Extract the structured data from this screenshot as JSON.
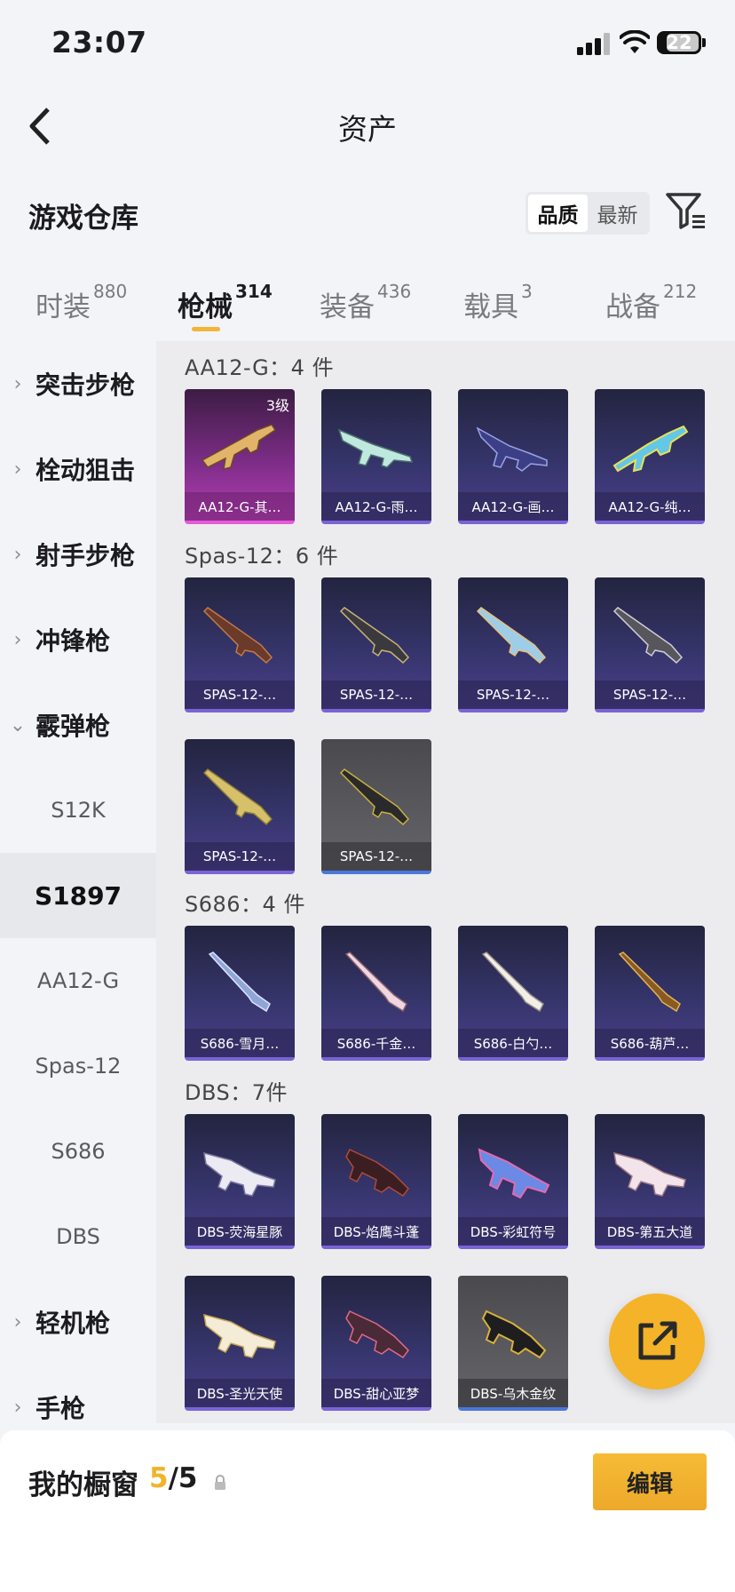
{
  "status_bar": {
    "time": "23:07",
    "battery": "22"
  },
  "nav": {
    "title": "资产"
  },
  "header": {
    "title": "游戏仓库",
    "sort_options": [
      "品质",
      "最新"
    ]
  },
  "tabs": [
    {
      "label": "时装",
      "count": "880"
    },
    {
      "label": "枪械",
      "count": "314"
    },
    {
      "label": "装备",
      "count": "436"
    },
    {
      "label": "载具",
      "count": "3"
    },
    {
      "label": "战备",
      "count": "212"
    }
  ],
  "sidebar": {
    "categories": [
      "突击步枪",
      "栓动狙击",
      "射手步枪",
      "冲锋枪",
      "霰弹枪"
    ],
    "sub_items": [
      "S12K",
      "S1897",
      "AA12-G",
      "Spas-12",
      "S686",
      "DBS"
    ],
    "more_categories": [
      "轻机枪",
      "手枪"
    ]
  },
  "groups": [
    {
      "title": "AA12-G：4 件",
      "items": [
        {
          "name": "AA12-G-其…",
          "level": "3级"
        },
        {
          "name": "AA12-G-雨…"
        },
        {
          "name": "AA12-G-画…"
        },
        {
          "name": "AA12-G-纯…"
        }
      ]
    },
    {
      "title": "Spas-12：6 件",
      "items": [
        {
          "name": "SPAS-12-…"
        },
        {
          "name": "SPAS-12-…"
        },
        {
          "name": "SPAS-12-…"
        },
        {
          "name": "SPAS-12-…"
        },
        {
          "name": "SPAS-12-…"
        },
        {
          "name": "SPAS-12-…"
        }
      ]
    },
    {
      "title": "S686：4 件",
      "items": [
        {
          "name": "S686-雪月…"
        },
        {
          "name": "S686-千金…"
        },
        {
          "name": "S686-白勺…"
        },
        {
          "name": "S686-葫芦…"
        }
      ]
    },
    {
      "title": "DBS：7件",
      "items": [
        {
          "name": "DBS-荧海星豚"
        },
        {
          "name": "DBS-焰鹰斗蓬"
        },
        {
          "name": "DBS-彩虹符号"
        },
        {
          "name": "DBS-第五大道"
        },
        {
          "name": "DBS-圣光天使"
        },
        {
          "name": "DBS-甜心亚梦"
        },
        {
          "name": "DBS-乌木金纹"
        }
      ]
    }
  ],
  "bottom_bar": {
    "label": "我的橱窗",
    "current": "5",
    "total": "/5",
    "edit_label": "编辑"
  },
  "colors": {
    "accent": "#f3b43a",
    "card_rare": "#7a63d6",
    "card_legend": "#b43fb5",
    "card_common": "#4a77d9"
  }
}
